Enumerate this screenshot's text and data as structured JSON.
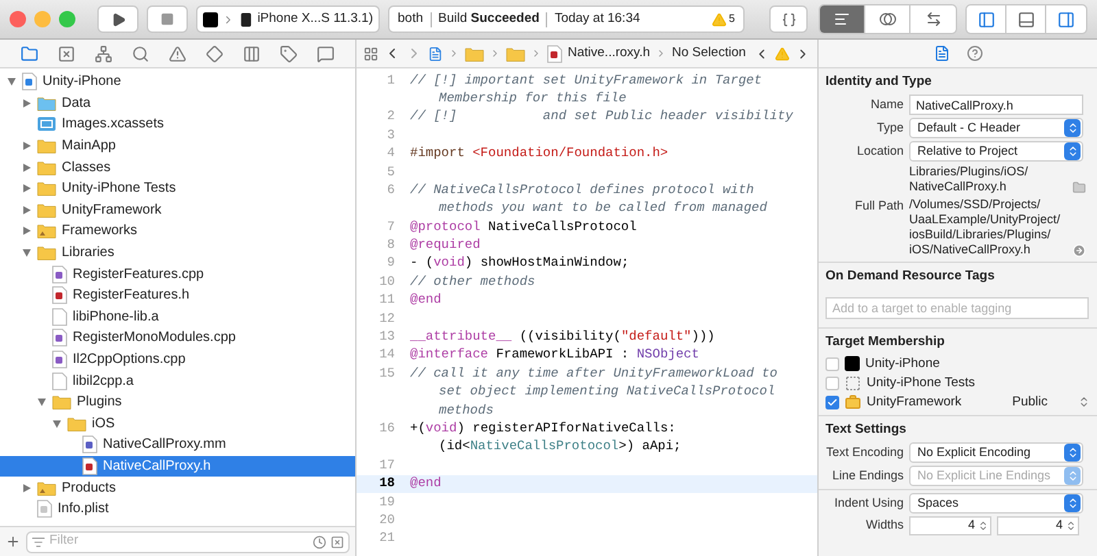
{
  "toolbar": {
    "scheme": "iPhone X...S 11.3.1)",
    "activity": {
      "target": "both",
      "status": "Build **Succeeded**",
      "time": "Today at 16:34",
      "warning_count": "5"
    },
    "editor_modes": [
      {
        "kind": "standard",
        "selected": true
      },
      {
        "kind": "assistant",
        "selected": false
      },
      {
        "kind": "version",
        "selected": false
      }
    ],
    "panel_toggles": [
      {
        "kind": "navigator",
        "on": true
      },
      {
        "kind": "debug",
        "on": false
      },
      {
        "kind": "utilities",
        "on": true
      }
    ]
  },
  "navigator": {
    "tabs": [
      {
        "kind": "project",
        "selected": true
      },
      {
        "kind": "source-control",
        "selected": false
      },
      {
        "kind": "symbols",
        "selected": false
      },
      {
        "kind": "find",
        "selected": false
      },
      {
        "kind": "issues",
        "selected": false
      },
      {
        "kind": "tests",
        "selected": false
      },
      {
        "kind": "debug",
        "selected": false
      },
      {
        "kind": "breakpoints",
        "selected": false
      },
      {
        "kind": "reports",
        "selected": false
      }
    ],
    "tree": [
      {
        "label": "Unity-iPhone",
        "kind": "project",
        "expanded": true,
        "selected": false,
        "children": [
          {
            "label": "Data",
            "kind": "blue-folder",
            "expanded": false,
            "selected": false
          },
          {
            "label": "Images.xcassets",
            "kind": "assets",
            "selected": false
          },
          {
            "label": "MainApp",
            "kind": "folder",
            "expanded": false,
            "selected": false
          },
          {
            "label": "Classes",
            "kind": "folder",
            "expanded": false,
            "selected": false
          },
          {
            "label": "Unity-iPhone Tests",
            "kind": "folder",
            "expanded": false,
            "selected": false
          },
          {
            "label": "UnityFramework",
            "kind": "folder",
            "expanded": false,
            "selected": false
          },
          {
            "label": "Frameworks",
            "kind": "special-folder",
            "expanded": false,
            "selected": false
          },
          {
            "label": "Libraries",
            "kind": "folder",
            "expanded": true,
            "selected": false,
            "children": [
              {
                "label": "RegisterFeatures.cpp",
                "kind": "cpp",
                "selected": false
              },
              {
                "label": "RegisterFeatures.h",
                "kind": "header",
                "selected": false
              },
              {
                "label": "libiPhone-lib.a",
                "kind": "library",
                "selected": false
              },
              {
                "label": "RegisterMonoModules.cpp",
                "kind": "cpp",
                "selected": false
              },
              {
                "label": "Il2CppOptions.cpp",
                "kind": "cpp",
                "selected": false
              },
              {
                "label": "libil2cpp.a",
                "kind": "library",
                "selected": false
              },
              {
                "label": "Plugins",
                "kind": "folder",
                "expanded": true,
                "selected": false,
                "children": [
                  {
                    "label": "iOS",
                    "kind": "folder",
                    "expanded": true,
                    "selected": false,
                    "children": [
                      {
                        "label": "NativeCallProxy.mm",
                        "kind": "objc",
                        "selected": false
                      },
                      {
                        "label": "NativeCallProxy.h",
                        "kind": "header",
                        "selected": true
                      }
                    ]
                  }
                ]
              }
            ]
          },
          {
            "label": "Products",
            "kind": "special-folder",
            "expanded": false,
            "selected": false
          },
          {
            "label": "Info.plist",
            "kind": "plist",
            "selected": false
          }
        ]
      }
    ],
    "filter": {
      "placeholder": "Filter"
    }
  },
  "editor": {
    "jump_bar": {
      "file": "Native...roxy.h",
      "selection": "No Selection"
    },
    "lines": [
      {
        "kind": "line",
        "number": "1",
        "current": false,
        "tokens": [
          {
            "kind": "comment",
            "text": "// [!] important set UnityFramework in Target"
          }
        ]
      },
      {
        "kind": "wrap",
        "current": false,
        "tokens": [
          {
            "kind": "comment",
            "text": "Membership for this file"
          }
        ]
      },
      {
        "kind": "line",
        "number": "2",
        "current": false,
        "tokens": [
          {
            "kind": "comment",
            "text": "// [!]           and set Public header visibility"
          }
        ]
      },
      {
        "kind": "line",
        "number": "3",
        "current": false
      },
      {
        "kind": "line",
        "number": "4",
        "current": false,
        "tokens": [
          {
            "kind": "preproc",
            "text": "#import "
          },
          {
            "kind": "string",
            "text": "<Foundation/Foundation.h>"
          }
        ]
      },
      {
        "kind": "line",
        "number": "5",
        "current": false
      },
      {
        "kind": "line",
        "number": "6",
        "current": false,
        "tokens": [
          {
            "kind": "comment",
            "text": "// NativeCallsProtocol defines protocol with"
          }
        ]
      },
      {
        "kind": "wrap",
        "current": false,
        "tokens": [
          {
            "kind": "comment",
            "text": "methods you want to be called from managed"
          }
        ]
      },
      {
        "kind": "line",
        "number": "7",
        "current": false,
        "tokens": [
          {
            "kind": "keyword",
            "text": "@protocol"
          },
          {
            "kind": "plain",
            "text": " NativeCallsProtocol"
          }
        ]
      },
      {
        "kind": "line",
        "number": "8",
        "current": false,
        "tokens": [
          {
            "kind": "keyword",
            "text": "@required"
          }
        ]
      },
      {
        "kind": "line",
        "number": "9",
        "current": false,
        "tokens": [
          {
            "kind": "plain",
            "text": "- ("
          },
          {
            "kind": "keyword",
            "text": "void"
          },
          {
            "kind": "plain",
            "text": ") showHostMainWindow;"
          }
        ]
      },
      {
        "kind": "line",
        "number": "10",
        "current": false,
        "tokens": [
          {
            "kind": "comment",
            "text": "// other methods"
          }
        ]
      },
      {
        "kind": "line",
        "number": "11",
        "current": false,
        "tokens": [
          {
            "kind": "keyword",
            "text": "@end"
          }
        ]
      },
      {
        "kind": "line",
        "number": "12",
        "current": false
      },
      {
        "kind": "line",
        "number": "13",
        "current": false,
        "tokens": [
          {
            "kind": "keyword",
            "text": "__attribute__"
          },
          {
            "kind": "plain",
            "text": " ((visibility("
          },
          {
            "kind": "string",
            "text": "\"default\""
          },
          {
            "kind": "plain",
            "text": ")))"
          }
        ]
      },
      {
        "kind": "line",
        "number": "14",
        "current": false,
        "tokens": [
          {
            "kind": "keyword",
            "text": "@interface"
          },
          {
            "kind": "plain",
            "text": " FrameworkLibAPI : "
          },
          {
            "kind": "type",
            "text": "NSObject"
          }
        ]
      },
      {
        "kind": "line",
        "number": "15",
        "current": false,
        "tokens": [
          {
            "kind": "comment",
            "text": "// call it any time after UnityFrameworkLoad to"
          }
        ]
      },
      {
        "kind": "wrap",
        "current": false,
        "tokens": [
          {
            "kind": "comment",
            "text": "set object implementing NativeCallsProtocol"
          }
        ]
      },
      {
        "kind": "wrap",
        "current": false,
        "tokens": [
          {
            "kind": "comment",
            "text": "methods"
          }
        ]
      },
      {
        "kind": "line",
        "number": "16",
        "current": false,
        "tokens": [
          {
            "kind": "plain",
            "text": "+("
          },
          {
            "kind": "keyword",
            "text": "void"
          },
          {
            "kind": "plain",
            "text": ") registerAPIforNativeCalls:"
          }
        ]
      },
      {
        "kind": "wrap",
        "current": false,
        "tokens": [
          {
            "kind": "plain",
            "text": "(id<"
          },
          {
            "kind": "protocol",
            "text": "NativeCallsProtocol"
          },
          {
            "kind": "plain",
            "text": ">) aApi;"
          }
        ]
      },
      {
        "kind": "line",
        "number": "17",
        "current": false
      },
      {
        "kind": "line",
        "number": "18",
        "current": true,
        "tokens": [
          {
            "kind": "keyword",
            "text": "@end"
          }
        ]
      },
      {
        "kind": "line",
        "number": "19",
        "current": false
      },
      {
        "kind": "line",
        "number": "20",
        "current": false
      },
      {
        "kind": "line",
        "number": "21",
        "current": false
      }
    ]
  },
  "inspector": {
    "tabs": [
      {
        "kind": "file",
        "selected": true
      },
      {
        "kind": "help",
        "selected": false
      }
    ],
    "identity": {
      "title": "Identity and Type",
      "fields": [
        {
          "kind": "text",
          "label": "Name",
          "value": "NativeCallProxy.h"
        },
        {
          "kind": "popup",
          "label": "Type",
          "value": "Default - C Header"
        },
        {
          "kind": "popup",
          "label": "Location",
          "value": "Relative to Project"
        },
        {
          "kind": "path",
          "value": "Libraries/Plugins/iOS/NativeCallProxy.h"
        },
        {
          "kind": "full-path",
          "label": "Full Path",
          "value": "/Volumes/SSD/Projects/UaaLExample/UnityProject/iosBuild/Libraries/Plugins/iOS/NativeCallProxy.h"
        }
      ]
    },
    "tags": {
      "title": "On Demand Resource Tags",
      "placeholder": "Add to a target to enable tagging"
    },
    "membership": {
      "title": "Target Membership",
      "targets": [
        {
          "label": "Unity-iPhone",
          "kind": "app",
          "checked": false
        },
        {
          "label": "Unity-iPhone Tests",
          "kind": "tests",
          "checked": false
        },
        {
          "label": "UnityFramework",
          "kind": "framework",
          "checked": true,
          "visibility": "Public"
        }
      ]
    },
    "text_settings": {
      "title": "Text Settings",
      "fields": [
        {
          "kind": "popup",
          "label": "Text Encoding",
          "value": "No Explicit Encoding",
          "disabled": false
        },
        {
          "kind": "popup",
          "label": "Line Endings",
          "value": "No Explicit Line Endings",
          "disabled": true
        },
        {
          "kind": "popup",
          "label": "Indent Using",
          "value": "Spaces",
          "disabled": false
        },
        {
          "kind": "steppers",
          "label": "Widths",
          "values": [
            "4",
            "4"
          ],
          "disabled": false
        }
      ]
    }
  }
}
